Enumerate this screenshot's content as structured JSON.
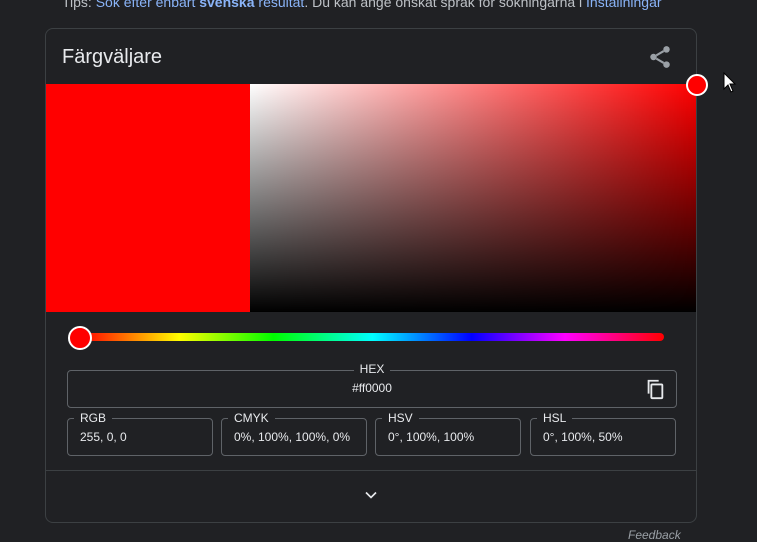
{
  "tips": {
    "prefix": "Tips: ",
    "link1": "Sök efter enbart",
    "bold": "svenska",
    "link2": " resultat",
    "middle": ". Du kan ange önskat språk för sökningarna i ",
    "link3": "Inställningar"
  },
  "picker": {
    "title": "Färgväljare",
    "hex_label": "HEX",
    "hex_value": "#ff0000",
    "fields": [
      {
        "label": "RGB",
        "value": "255, 0, 0"
      },
      {
        "label": "CMYK",
        "value": "0%, 100%, 100%, 0%"
      },
      {
        "label": "HSV",
        "value": "0°, 100%, 100%"
      },
      {
        "label": "HSL",
        "value": "0°, 100%, 50%"
      }
    ],
    "selected_color": "#ff0000",
    "hue_position": 0
  },
  "feedback": "Feedback",
  "icons": {
    "share": "share-icon",
    "copy": "copy-icon",
    "expand": "chevron-down-icon"
  }
}
